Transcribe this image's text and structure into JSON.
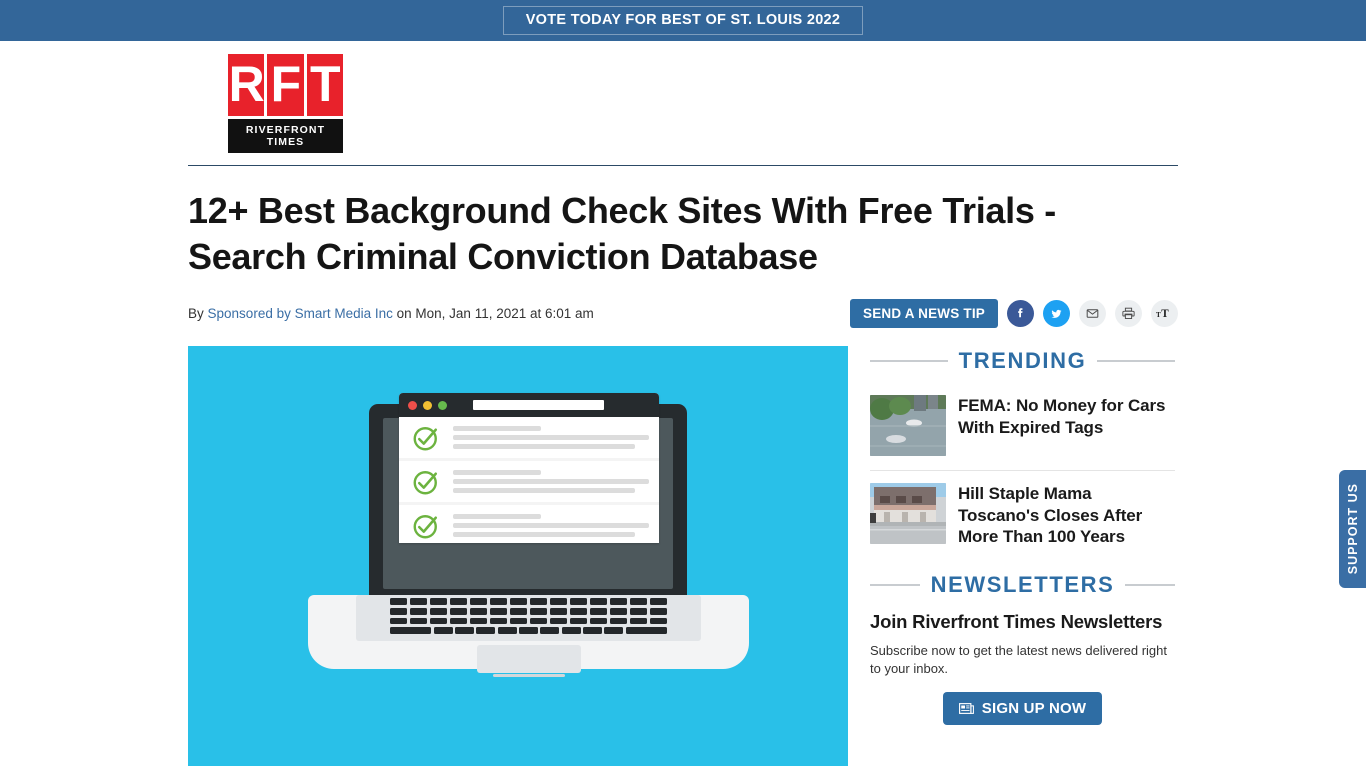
{
  "promo": {
    "label": "VOTE TODAY FOR BEST OF ST. LOUIS 2022",
    "bg_color": "#336699"
  },
  "logo": {
    "letters": [
      "R",
      "F",
      "T"
    ],
    "wordmark": "RIVERFRONT TIMES",
    "red": "#e8222b"
  },
  "article": {
    "headline": "12+ Best Background Check Sites With Free Trials - Search Criminal Conviction Database",
    "byline_prefix": "By",
    "author": "Sponsored by Smart Media Inc",
    "byline_suffix": "on Mon, Jan 11, 2021 at 6:01 am"
  },
  "share": {
    "news_tip_label": "SEND A NEWS TIP",
    "icons": [
      {
        "name": "facebook-icon",
        "label": "Facebook",
        "color": "#3b5998"
      },
      {
        "name": "twitter-icon",
        "label": "Twitter",
        "color": "#1da1f2"
      },
      {
        "name": "email-icon",
        "label": "Email",
        "color": "#eceff1"
      },
      {
        "name": "print-icon",
        "label": "Print",
        "color": "#eceff1"
      },
      {
        "name": "text-size-icon",
        "label": "Text size",
        "color": "#eceff1"
      }
    ]
  },
  "hero": {
    "alt": "Laptop showing a checklist in a browser window",
    "bg_color": "#29c0e8",
    "checklist_rows": 3
  },
  "sidebar": {
    "trending": {
      "heading": "TRENDING",
      "items": [
        {
          "title": "FEMA: No Money for Cars With Expired Tags",
          "thumb_alt": "Flooded street with submerged cars"
        },
        {
          "title": "Hill Staple Mama Toscano's Closes After More Than 100 Years",
          "thumb_alt": "Brick storefront building"
        }
      ]
    },
    "newsletters": {
      "heading": "NEWSLETTERS",
      "subheading": "Join Riverfront Times Newsletters",
      "description": "Subscribe now to get the latest news delivered right to your inbox.",
      "button_label": "SIGN UP NOW"
    }
  },
  "support_tab": {
    "label": "SUPPORT US",
    "color": "#3a6ea5"
  }
}
